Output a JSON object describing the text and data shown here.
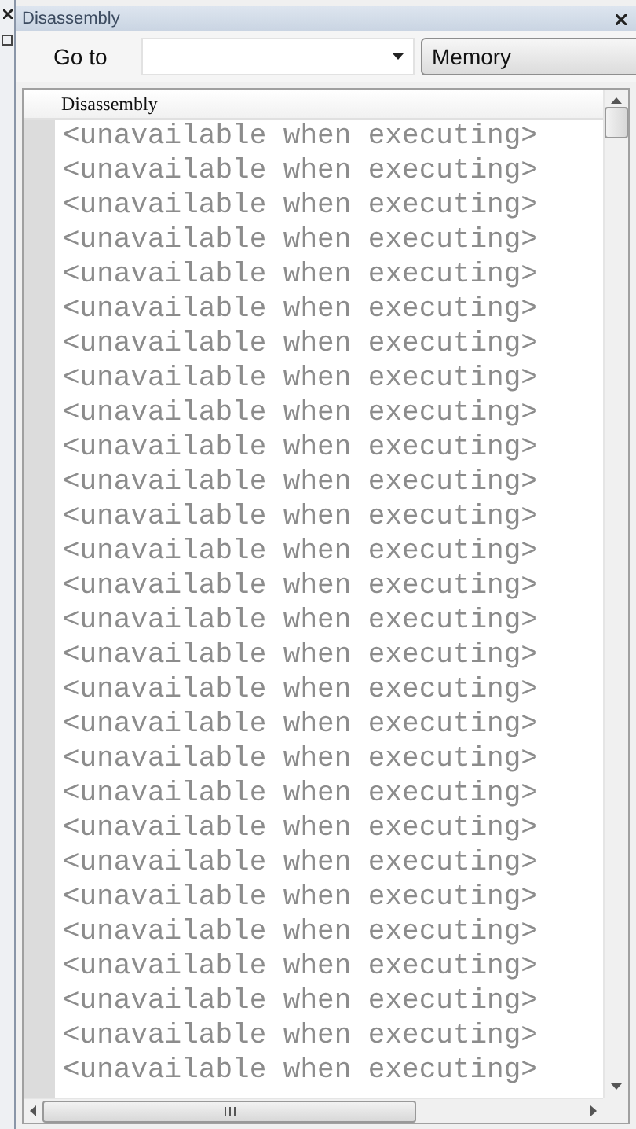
{
  "window": {
    "title": "Disassembly"
  },
  "toolbar": {
    "goto_label": "Go to",
    "memory_button": "Memory"
  },
  "panel": {
    "header": "Disassembly",
    "lines": [
      "<unavailable when executing>",
      "<unavailable when executing>",
      "<unavailable when executing>",
      "<unavailable when executing>",
      "<unavailable when executing>",
      "<unavailable when executing>",
      "<unavailable when executing>",
      "<unavailable when executing>",
      "<unavailable when executing>",
      "<unavailable when executing>",
      "<unavailable when executing>",
      "<unavailable when executing>",
      "<unavailable when executing>",
      "<unavailable when executing>",
      "<unavailable when executing>",
      "<unavailable when executing>",
      "<unavailable when executing>",
      "<unavailable when executing>",
      "<unavailable when executing>",
      "<unavailable when executing>",
      "<unavailable when executing>",
      "<unavailable when executing>",
      "<unavailable when executing>",
      "<unavailable when executing>",
      "<unavailable when executing>",
      "<unavailable when executing>",
      "<unavailable when executing>",
      "<unavailable when executing>"
    ]
  }
}
